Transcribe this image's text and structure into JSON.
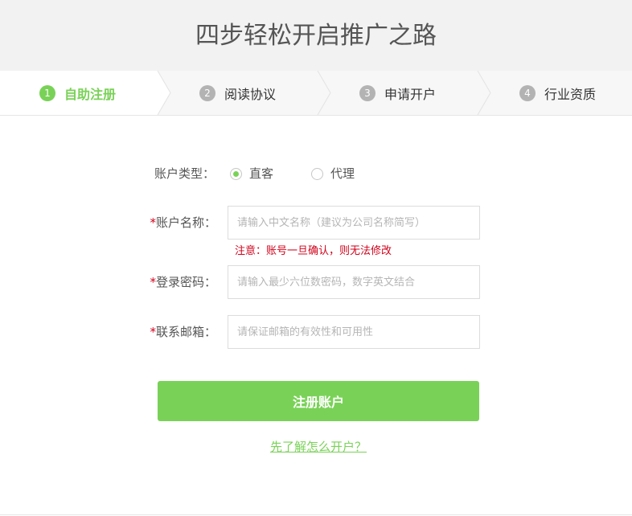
{
  "header": {
    "title": "四步轻松开启推广之路"
  },
  "steps": [
    {
      "num": "1",
      "label": "自助注册",
      "active": true
    },
    {
      "num": "2",
      "label": "阅读协议",
      "active": false
    },
    {
      "num": "3",
      "label": "申请开户",
      "active": false
    },
    {
      "num": "4",
      "label": "行业资质",
      "active": false
    }
  ],
  "form": {
    "account_type": {
      "label": "账户类型：",
      "options": [
        "直客",
        "代理"
      ],
      "selected": "直客"
    },
    "required_mark": "*",
    "account_name": {
      "label": "账户名称：",
      "placeholder": "请输入中文名称（建议为公司名称简写）",
      "value": ""
    },
    "notice": "注意：账号一旦确认，则无法修改",
    "password": {
      "label": "登录密码：",
      "placeholder": "请输入最少六位数密码，数字英文结合",
      "value": ""
    },
    "email": {
      "label": "联系邮箱：",
      "placeholder": "请保证邮箱的有效性和可用性",
      "value": ""
    },
    "submit_label": "注册账户",
    "help_link": "先了解怎么开户？"
  },
  "colors": {
    "accent": "#79d257",
    "error": "#d0021b",
    "header_bg": "#f2f2f2"
  }
}
